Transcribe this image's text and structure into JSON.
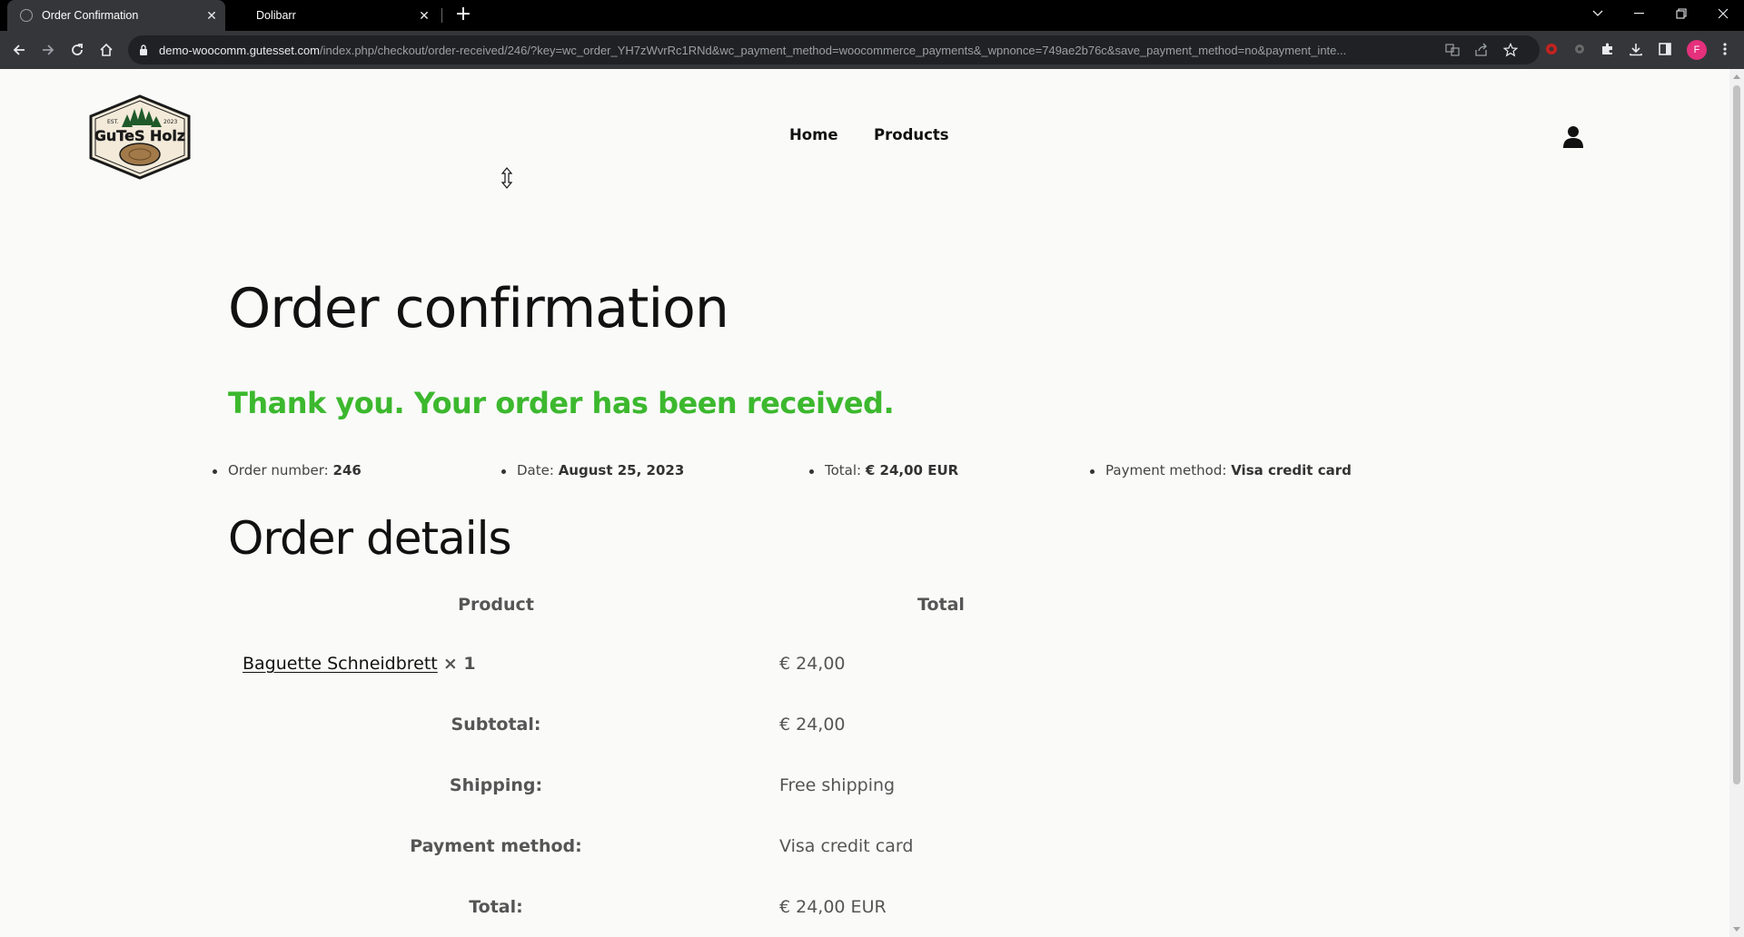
{
  "browser": {
    "tabs": [
      {
        "label": "Order Confirmation",
        "active": true
      },
      {
        "label": "Dolibarr",
        "active": false
      }
    ],
    "url_host": "demo-woocomm.gutesset.com",
    "url_path": "/index.php/checkout/order-received/246/?key=wc_order_YH7zWvrRc1RNd&wc_payment_method=woocommerce_payments&_wpnonce=749ae2b76c&save_payment_method=no&payment_inte...",
    "profile_initial": "F",
    "icons": [
      "back-icon",
      "forward-icon",
      "reload-icon",
      "home-icon",
      "lock-icon",
      "translate-icon",
      "share-icon",
      "star-icon",
      "extension-red-icon",
      "extension-gear-icon",
      "puzzle-icon",
      "download-icon",
      "sidepanel-icon",
      "menu-icon"
    ]
  },
  "site": {
    "logo_text": "GuTeS Holz",
    "logo_left": "EST.",
    "logo_right": "2023",
    "nav": [
      "Home",
      "Products"
    ]
  },
  "page": {
    "title": "Order confirmation",
    "thanks": "Thank you. Your order has been received.",
    "overview": {
      "order_number_label": "Order number:",
      "order_number": "246",
      "date_label": "Date:",
      "date": "August 25, 2023",
      "total_label": "Total:",
      "total": "€ 24,00 EUR",
      "payment_label": "Payment method:",
      "payment": "Visa credit card"
    },
    "details_heading": "Order details",
    "table": {
      "col_product": "Product",
      "col_total": "Total",
      "product_name": "Baguette Schneidbrett",
      "product_qty": "× 1",
      "product_total": "€ 24,00",
      "subtotal_label": "Subtotal:",
      "subtotal": "€ 24,00",
      "shipping_label": "Shipping:",
      "shipping": "Free shipping",
      "payment_label": "Payment method:",
      "payment": "Visa credit card",
      "total_label": "Total:",
      "total": "€ 24,00 EUR"
    }
  },
  "colors": {
    "accent_green": "#3cb82e",
    "chrome_dark": "#35363a",
    "profile": "#e5307c"
  }
}
